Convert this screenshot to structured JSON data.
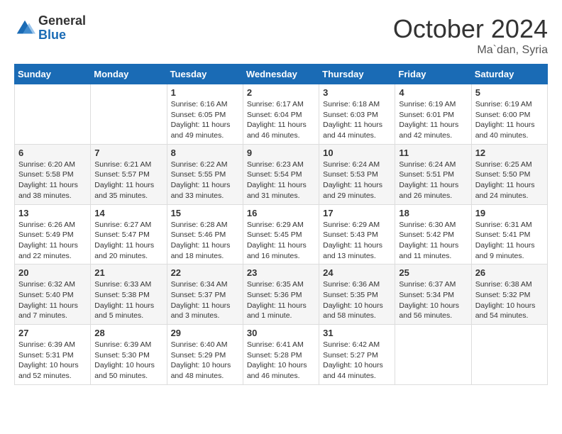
{
  "header": {
    "logo_general": "General",
    "logo_blue": "Blue",
    "title": "October 2024",
    "location": "Ma`dan, Syria"
  },
  "days_of_week": [
    "Sunday",
    "Monday",
    "Tuesday",
    "Wednesday",
    "Thursday",
    "Friday",
    "Saturday"
  ],
  "weeks": [
    [
      {
        "day": "",
        "info": ""
      },
      {
        "day": "",
        "info": ""
      },
      {
        "day": "1",
        "info": "Sunrise: 6:16 AM\nSunset: 6:05 PM\nDaylight: 11 hours and 49 minutes."
      },
      {
        "day": "2",
        "info": "Sunrise: 6:17 AM\nSunset: 6:04 PM\nDaylight: 11 hours and 46 minutes."
      },
      {
        "day": "3",
        "info": "Sunrise: 6:18 AM\nSunset: 6:03 PM\nDaylight: 11 hours and 44 minutes."
      },
      {
        "day": "4",
        "info": "Sunrise: 6:19 AM\nSunset: 6:01 PM\nDaylight: 11 hours and 42 minutes."
      },
      {
        "day": "5",
        "info": "Sunrise: 6:19 AM\nSunset: 6:00 PM\nDaylight: 11 hours and 40 minutes."
      }
    ],
    [
      {
        "day": "6",
        "info": "Sunrise: 6:20 AM\nSunset: 5:58 PM\nDaylight: 11 hours and 38 minutes."
      },
      {
        "day": "7",
        "info": "Sunrise: 6:21 AM\nSunset: 5:57 PM\nDaylight: 11 hours and 35 minutes."
      },
      {
        "day": "8",
        "info": "Sunrise: 6:22 AM\nSunset: 5:55 PM\nDaylight: 11 hours and 33 minutes."
      },
      {
        "day": "9",
        "info": "Sunrise: 6:23 AM\nSunset: 5:54 PM\nDaylight: 11 hours and 31 minutes."
      },
      {
        "day": "10",
        "info": "Sunrise: 6:24 AM\nSunset: 5:53 PM\nDaylight: 11 hours and 29 minutes."
      },
      {
        "day": "11",
        "info": "Sunrise: 6:24 AM\nSunset: 5:51 PM\nDaylight: 11 hours and 26 minutes."
      },
      {
        "day": "12",
        "info": "Sunrise: 6:25 AM\nSunset: 5:50 PM\nDaylight: 11 hours and 24 minutes."
      }
    ],
    [
      {
        "day": "13",
        "info": "Sunrise: 6:26 AM\nSunset: 5:49 PM\nDaylight: 11 hours and 22 minutes."
      },
      {
        "day": "14",
        "info": "Sunrise: 6:27 AM\nSunset: 5:47 PM\nDaylight: 11 hours and 20 minutes."
      },
      {
        "day": "15",
        "info": "Sunrise: 6:28 AM\nSunset: 5:46 PM\nDaylight: 11 hours and 18 minutes."
      },
      {
        "day": "16",
        "info": "Sunrise: 6:29 AM\nSunset: 5:45 PM\nDaylight: 11 hours and 16 minutes."
      },
      {
        "day": "17",
        "info": "Sunrise: 6:29 AM\nSunset: 5:43 PM\nDaylight: 11 hours and 13 minutes."
      },
      {
        "day": "18",
        "info": "Sunrise: 6:30 AM\nSunset: 5:42 PM\nDaylight: 11 hours and 11 minutes."
      },
      {
        "day": "19",
        "info": "Sunrise: 6:31 AM\nSunset: 5:41 PM\nDaylight: 11 hours and 9 minutes."
      }
    ],
    [
      {
        "day": "20",
        "info": "Sunrise: 6:32 AM\nSunset: 5:40 PM\nDaylight: 11 hours and 7 minutes."
      },
      {
        "day": "21",
        "info": "Sunrise: 6:33 AM\nSunset: 5:38 PM\nDaylight: 11 hours and 5 minutes."
      },
      {
        "day": "22",
        "info": "Sunrise: 6:34 AM\nSunset: 5:37 PM\nDaylight: 11 hours and 3 minutes."
      },
      {
        "day": "23",
        "info": "Sunrise: 6:35 AM\nSunset: 5:36 PM\nDaylight: 11 hours and 1 minute."
      },
      {
        "day": "24",
        "info": "Sunrise: 6:36 AM\nSunset: 5:35 PM\nDaylight: 10 hours and 58 minutes."
      },
      {
        "day": "25",
        "info": "Sunrise: 6:37 AM\nSunset: 5:34 PM\nDaylight: 10 hours and 56 minutes."
      },
      {
        "day": "26",
        "info": "Sunrise: 6:38 AM\nSunset: 5:32 PM\nDaylight: 10 hours and 54 minutes."
      }
    ],
    [
      {
        "day": "27",
        "info": "Sunrise: 6:39 AM\nSunset: 5:31 PM\nDaylight: 10 hours and 52 minutes."
      },
      {
        "day": "28",
        "info": "Sunrise: 6:39 AM\nSunset: 5:30 PM\nDaylight: 10 hours and 50 minutes."
      },
      {
        "day": "29",
        "info": "Sunrise: 6:40 AM\nSunset: 5:29 PM\nDaylight: 10 hours and 48 minutes."
      },
      {
        "day": "30",
        "info": "Sunrise: 6:41 AM\nSunset: 5:28 PM\nDaylight: 10 hours and 46 minutes."
      },
      {
        "day": "31",
        "info": "Sunrise: 6:42 AM\nSunset: 5:27 PM\nDaylight: 10 hours and 44 minutes."
      },
      {
        "day": "",
        "info": ""
      },
      {
        "day": "",
        "info": ""
      }
    ]
  ]
}
